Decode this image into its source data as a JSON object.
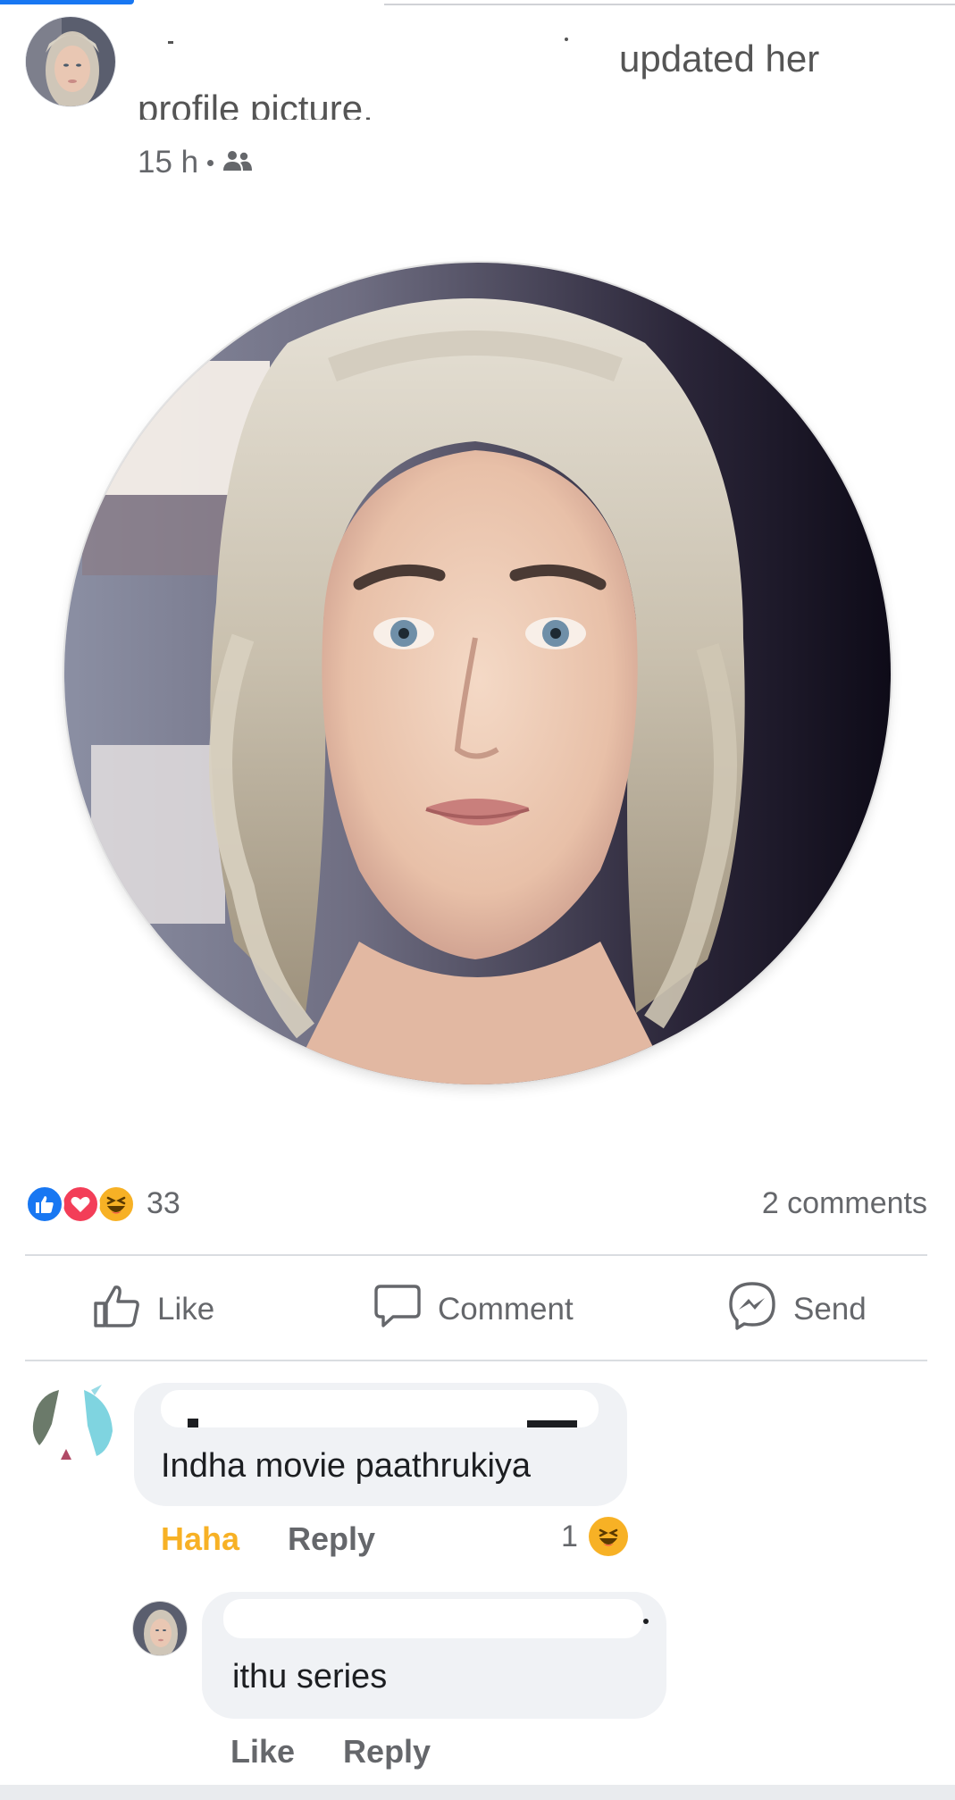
{
  "post": {
    "action_text": "updated her",
    "action_text_line2": "profile picture.",
    "time": "15 h",
    "audience_icon": "friends-icon"
  },
  "reactions": {
    "icons": [
      "like-icon",
      "love-icon",
      "haha-icon"
    ],
    "count": "33",
    "comments_count": "2 comments"
  },
  "actions": {
    "like": "Like",
    "comment": "Comment",
    "send": "Send"
  },
  "comments": [
    {
      "text": "Indha movie paathrukiya",
      "reaction_label": "Haha",
      "reply_label": "Reply",
      "reaction_count": "1",
      "reaction_icon": "haha-icon"
    },
    {
      "text": "ithu series",
      "like_label": "Like",
      "reply_label": "Reply"
    }
  ],
  "colors": {
    "facebook_blue": "#1877f2",
    "love_red": "#f33e58",
    "haha_yellow": "#f7b125",
    "secondary_text": "#65676b",
    "bubble_bg": "#f0f2f5"
  }
}
